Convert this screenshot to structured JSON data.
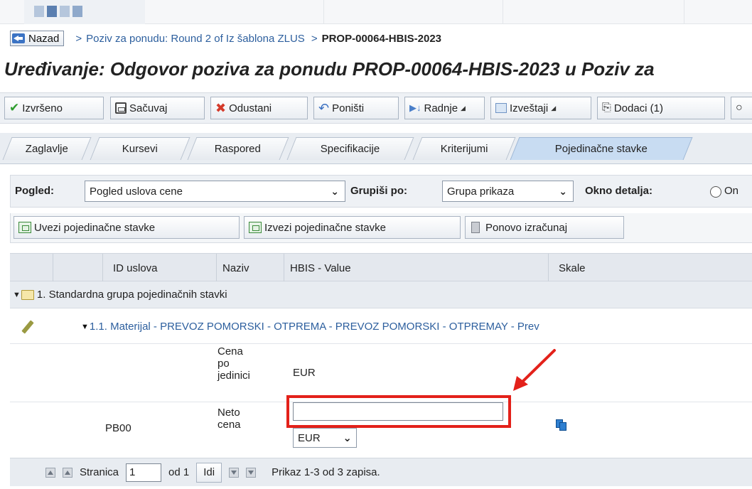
{
  "breadcrumb": {
    "back_label": "Nazad",
    "sep1": ">",
    "link": "Poziv za ponudu: Round 2 of Iz šablona ZLUS",
    "sep2": ">",
    "current": "PROP-00064-HBIS-2023"
  },
  "page_title": "Uređivanje: Odgovor poziva za ponudu PROP-00064-HBIS-2023 u Poziv za",
  "toolbar": {
    "done": "Izvršeno",
    "save": "Sačuvaj",
    "cancel": "Odustani",
    "undo": "Poništi",
    "actions": "Radnje",
    "reports": "Izveštaji",
    "attachments": "Dodaci (1)"
  },
  "tabs": [
    "Zaglavlje",
    "Kursevi",
    "Raspored",
    "Specifikacije",
    "Kriterijumi",
    "Pojedinačne stavke"
  ],
  "viewbar": {
    "view_label": "Pogled:",
    "view_value": "Pogled uslova cene",
    "group_label": "Grupiši po:",
    "group_value": "Grupa prikaza",
    "detail_label": "Okno detalja:",
    "detail_option": "On"
  },
  "actions": {
    "import": "Uvezi pojedinačne stavke",
    "export": "Izvezi pojedinačne stavke",
    "recalc": "Ponovo izračunaj"
  },
  "grid": {
    "columns": [
      "ID uslova",
      "Naziv",
      "HBIS - Value",
      "Skale"
    ],
    "group_row": "1. Standardna grupa pojedinačnih stavki",
    "item_row": "1.1. Materijal - PREVOZ POMORSKI - OTPREMA - PREVOZ POMORSKI - OTPREMAY - Prev",
    "unit_price": {
      "label_lines": [
        "Cena",
        "po",
        "jedinici"
      ],
      "currency": "EUR"
    },
    "net_price": {
      "condition_id": "PB00",
      "label_lines": [
        "Neto",
        "cena"
      ],
      "input_value": "",
      "currency": "EUR"
    }
  },
  "pager": {
    "page_label": "Stranica",
    "page_value": "1",
    "of_label": "od 1",
    "go_label": "Idi",
    "summary": "Prikaz 1-3 od 3 zapisa."
  },
  "colors": {
    "highlight": "#e3211a",
    "link": "#2d5f9e",
    "active_tab": "#c8dcf2"
  }
}
